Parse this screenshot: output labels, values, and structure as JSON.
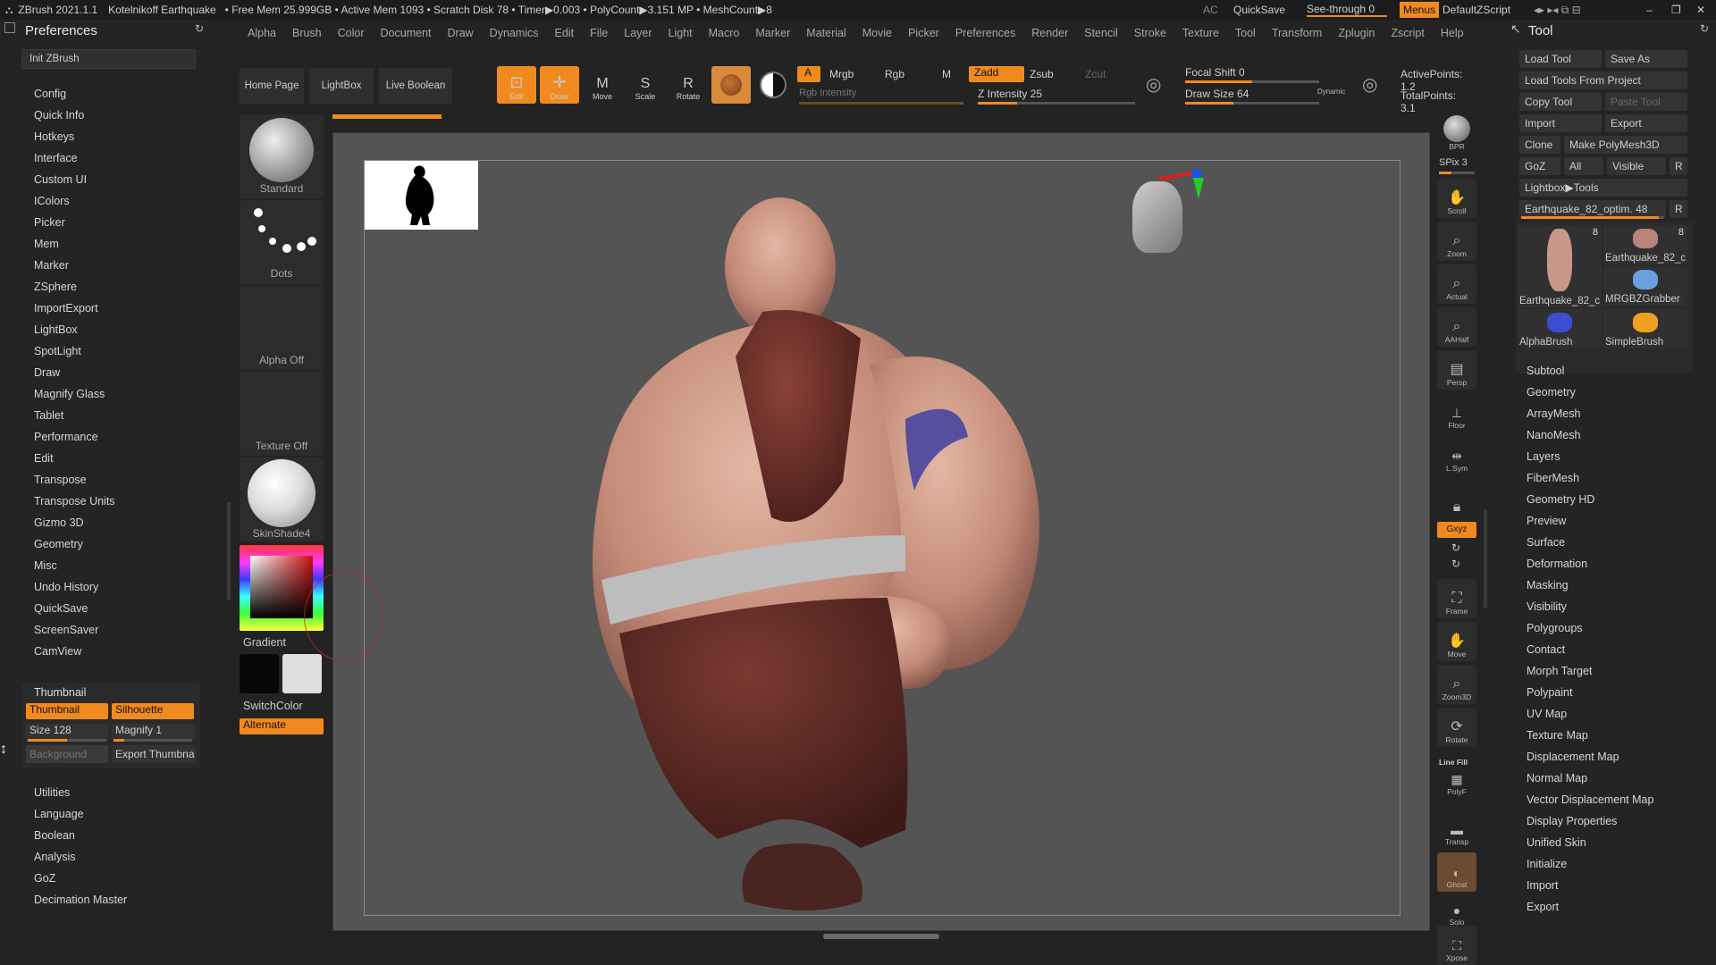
{
  "titlebar": {
    "app": "ZBrush 2021.1.1",
    "file": "Kotelnikoff Earthquake",
    "stats": "• Free Mem 25.999GB • Active Mem 1093 • Scratch Disk 78 • Timer▶0.003 • PolyCount▶3.151 MP • MeshCount▶8",
    "ac": "AC",
    "quicksave": "QuickSave",
    "see_through": "See-through  0",
    "menus": "Menus",
    "default_zscript": "DefaultZScript"
  },
  "menubar": [
    "Alpha",
    "Brush",
    "Color",
    "Document",
    "Draw",
    "Dynamics",
    "Edit",
    "File",
    "Layer",
    "Light",
    "Macro",
    "Marker",
    "Material",
    "Movie",
    "Picker",
    "Preferences",
    "Render",
    "Stencil",
    "Stroke",
    "Texture",
    "Tool",
    "Transform",
    "Zplugin",
    "Zscript",
    "Help"
  ],
  "left": {
    "title": "Preferences",
    "init": "Init ZBrush",
    "items_top": [
      "Config",
      "Quick Info",
      "Hotkeys",
      "Interface",
      "Custom UI",
      "IColors",
      "Picker",
      "Mem",
      "Marker",
      "ZSphere",
      "ImportExport",
      "LightBox",
      "SpotLight",
      "Draw",
      "Magnify Glass",
      "Tablet",
      "Performance",
      "Edit",
      "Transpose",
      "Transpose Units",
      "Gizmo 3D",
      "Geometry",
      "Misc",
      "Undo History",
      "QuickSave",
      "ScreenSaver",
      "CamView"
    ],
    "thumbnail_header": "Thumbnail",
    "thumbnail_btn": "Thumbnail",
    "silhouette_btn": "Silhouette",
    "size_label": "Size 128",
    "magnify_label": "Magnify 1",
    "background_placeholder": "Background",
    "export_thumb": "Export Thumbna",
    "items_bottom": [
      "Utilities",
      "Language",
      "Boolean",
      "Analysis",
      "GoZ",
      "Decimation Master"
    ]
  },
  "shelf": {
    "home": "Home Page",
    "lightbox": "LightBox",
    "live_boolean": "Live Boolean",
    "edit": "Edit",
    "draw": "Draw",
    "move": "Move",
    "scale": "Scale",
    "rotate": "Rotate",
    "a": "A",
    "mrgb": "Mrgb",
    "rgb": "Rgb",
    "m": "M",
    "rgb_intensity": "Rgb Intensity",
    "zadd": "Zadd",
    "zsub": "Zsub",
    "zcut": "Zcut",
    "z_intensity": "Z Intensity 25",
    "z_intensity_value": 25,
    "focal_shift": "Focal Shift 0",
    "draw_size": "Draw Size 64",
    "draw_size_value": 64,
    "dynamic": "Dynamic",
    "active_points": "ActivePoints: 1.2",
    "total_points": "TotalPoints: 3.1"
  },
  "brushes": {
    "standard": "Standard",
    "dots": "Dots",
    "alpha_off": "Alpha Off",
    "texture_off": "Texture Off",
    "material": "SkinShade4",
    "gradient": "Gradient",
    "switchcolor": "SwitchColor",
    "alternate": "Alternate"
  },
  "rightbar": {
    "bpr": "BPR",
    "spix": "SPix 3",
    "scroll": "Scroll",
    "zoom": "Zoom",
    "actual": "Actual",
    "aahalf": "AAHalf",
    "persp": "Persp",
    "floor": "Floor",
    "lsym": "L.Sym",
    "xyz": "Gxyz",
    "frame": "Frame",
    "move": "Move",
    "zoom3d": "Zoom3D",
    "rotate": "Rotate",
    "linefill": "Line Fill",
    "polyf": "PolyF",
    "transp": "Transp",
    "ghost": "Ghost",
    "solo": "Solo",
    "xpose": "Xpose"
  },
  "tool": {
    "title": "Tool",
    "load_tool": "Load Tool",
    "save_as": "Save As",
    "load_from_project": "Load Tools From Project",
    "copy_tool": "Copy Tool",
    "paste_tool": "Paste Tool",
    "import": "Import",
    "export": "Export",
    "clone": "Clone",
    "make_polymesh": "Make PolyMesh3D",
    "goz": "GoZ",
    "all": "All",
    "visible": "Visible",
    "r": "R",
    "lightbox_tools": "Lightbox▶Tools",
    "current_tool": "Earthquake_82_optim. 48",
    "thumbs": [
      {
        "label": "Earthquake_82_c",
        "count": "8"
      },
      {
        "label": "Earthquake_82_c",
        "count": "8"
      },
      {
        "label": "MRGBZGrabber",
        "count": ""
      },
      {
        "label": "AlphaBrush",
        "count": ""
      },
      {
        "label": "SimpleBrush",
        "count": ""
      }
    ],
    "items": [
      "Subtool",
      "Geometry",
      "ArrayMesh",
      "NanoMesh",
      "Layers",
      "FiberMesh",
      "Geometry HD",
      "Preview",
      "Surface",
      "Deformation",
      "Masking",
      "Visibility",
      "Polygroups",
      "Contact",
      "Morph Target",
      "Polypaint",
      "UV Map",
      "Texture Map",
      "Displacement Map",
      "Normal Map",
      "Vector Displacement Map",
      "Display Properties",
      "Unified Skin",
      "Initialize",
      "Import",
      "Export"
    ]
  },
  "colors": {
    "accent": "#f08a1e",
    "bg": "#232323",
    "viewport": "#545454"
  }
}
